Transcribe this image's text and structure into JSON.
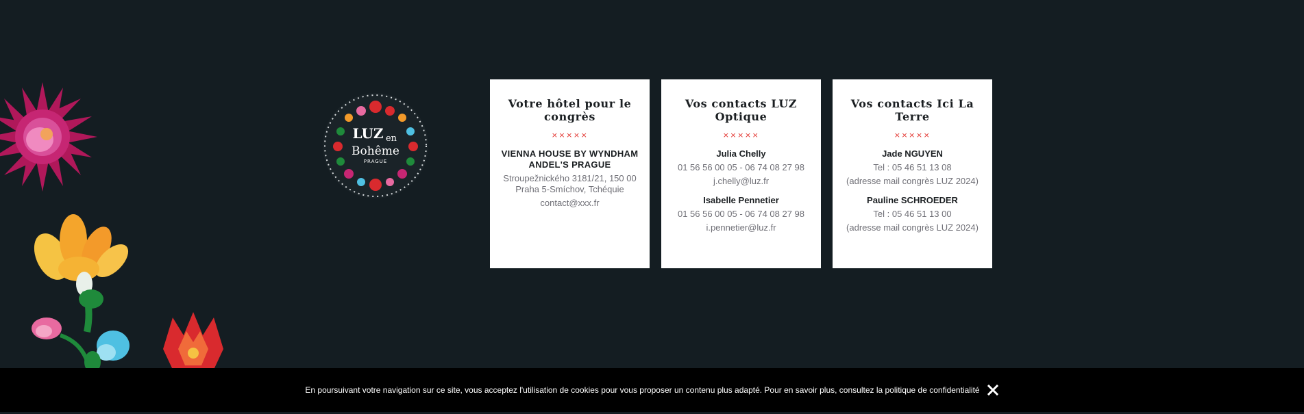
{
  "logo": {
    "text_top": "LUZ",
    "text_en": "en",
    "text_boheme": "Bohême",
    "text_city": "PRAGUE"
  },
  "cards": [
    {
      "title": "Votre hôtel pour le congrès",
      "stars": "×××××",
      "hotel": {
        "name": "VIENNA HOUSE BY WYNDHAM ANDEL'S PRAGUE",
        "address": "Stroupežnického 3181/21, 150 00 Praha 5-Smíchov, Tchéquie",
        "email": "contact@xxx.fr"
      }
    },
    {
      "title": "Vos contacts LUZ Optique",
      "stars": "×××××",
      "contacts": [
        {
          "name": "Julia Chelly",
          "phone": "01 56 56 00 05 - 06 74 08 27 98",
          "email": "j.chelly@luz.fr"
        },
        {
          "name": "Isabelle Pennetier",
          "phone": "01 56 56 00 05 - 06 74 08 27 98",
          "email": "i.pennetier@luz.fr"
        }
      ]
    },
    {
      "title": "Vos contacts Ici La Terre",
      "stars": "×××××",
      "contacts": [
        {
          "name": "Jade NGUYEN",
          "phone": "Tel : 05 46 51 13 08",
          "email": "(adresse mail congrès LUZ 2024)"
        },
        {
          "name": "Pauline SCHROEDER",
          "phone": "Tel : 05 46 51 13 00",
          "email": "(adresse mail congrès LUZ 2024)"
        }
      ]
    }
  ],
  "cookie_bar": {
    "message": "En poursuivant votre navigation sur ce site, vous acceptez l'utilisation de cookies pour vous proposer un contenu plus adapté. Pour en savoir plus, consultez la politique de confidentialité"
  },
  "colors": {
    "background": "#141d22",
    "card": "#ffffff",
    "accent": "#e3342f",
    "cookie_bar": "#000000"
  },
  "icons": {
    "close": "close-icon",
    "flowers": "embroidered-flowers-decoration"
  }
}
